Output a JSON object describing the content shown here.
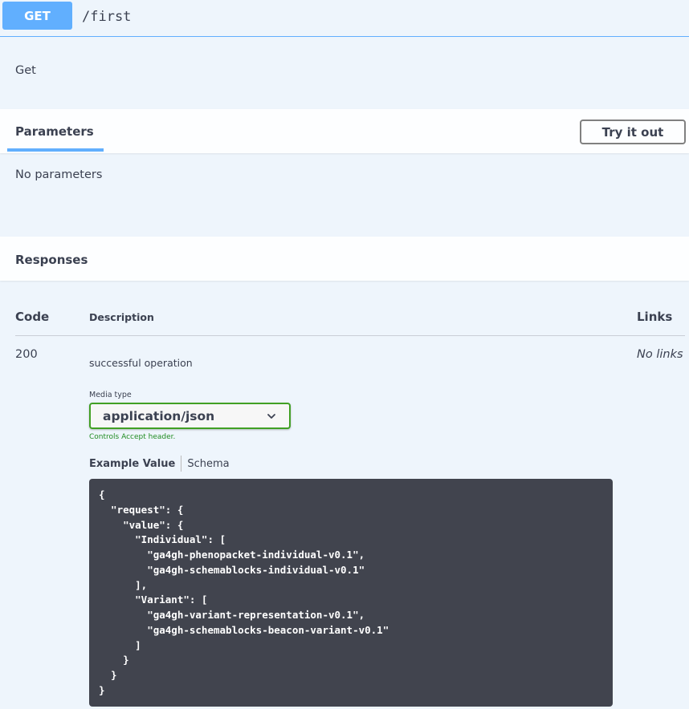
{
  "operation": {
    "method": "GET",
    "path": "/first",
    "summary": "Get"
  },
  "parameters": {
    "tab_label": "Parameters",
    "try_button_label": "Try it out",
    "empty_text": "No parameters"
  },
  "responses": {
    "title": "Responses",
    "columns": {
      "code": "Code",
      "description": "Description",
      "links": "Links"
    },
    "rows": [
      {
        "code": "200",
        "description": "successful operation",
        "links": "No links",
        "media_type_label": "Media type",
        "media_type_value": "application/json",
        "controls_note": "Controls Accept header.",
        "example_tab": "Example Value",
        "schema_tab": "Schema",
        "example_code": "{\n  \"request\": {\n    \"value\": {\n      \"Individual\": [\n        \"ga4gh-phenopacket-individual-v0.1\",\n        \"ga4gh-schemablocks-individual-v0.1\"\n      ],\n      \"Variant\": [\n        \"ga4gh-variant-representation-v0.1\",\n        \"ga4gh-schemablocks-beacon-variant-v0.1\"\n      ]\n    }\n  }\n}"
      }
    ]
  },
  "colors": {
    "get_accent": "#61affe",
    "background": "#eef5fc",
    "select_border": "#41a024",
    "note_green": "#218c21",
    "code_bg": "#41444e"
  },
  "icons": {
    "select_chevron": "chevron-down-icon"
  }
}
